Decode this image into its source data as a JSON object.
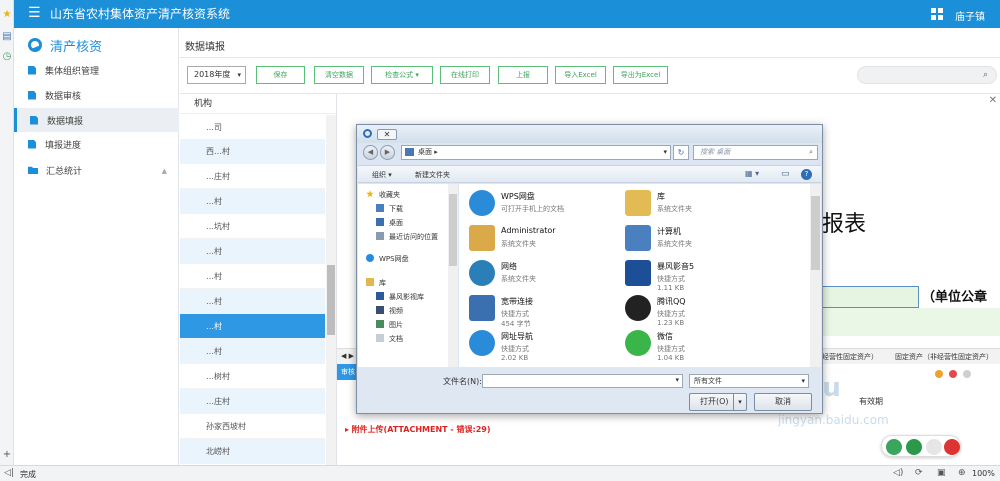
{
  "app": {
    "title": "山东省农村集体资产清产核资系统",
    "user": "庙子镇",
    "brand": "清产核资"
  },
  "sidebar": {
    "items": [
      {
        "label": "集体组织管理"
      },
      {
        "label": "数据审核"
      },
      {
        "label": "数据填报",
        "active": true
      },
      {
        "label": "填报进度"
      },
      {
        "label": "汇总统计"
      }
    ]
  },
  "breadcrumb": "数据填报",
  "toolbar": {
    "year": "2018年度",
    "buttons": [
      "保存",
      "清空数据",
      "检查公式",
      "在线打印",
      "上报",
      "导入Excel",
      "导出为Excel"
    ]
  },
  "org": {
    "header": "机构",
    "rows": [
      "…司",
      "西…村",
      "…庄村",
      "…村",
      "…坑村",
      "…村",
      "…村",
      "…村",
      "…村",
      "…村",
      "…树村",
      "…庄村",
      "孙家西坡村",
      "北崂村"
    ],
    "selected_index": 8
  },
  "content": {
    "title_fragment": "报表",
    "unit_fragment": "（单位公章",
    "tabs": [
      "经营性固定资产）",
      "固定资产（非经营性固定资产）"
    ],
    "sub_header": "审核",
    "attachment": "附件上传(ATTACHMENT - 错误:29)",
    "col_right": "有效期"
  },
  "dialog": {
    "title": "打开",
    "path": "桌面",
    "search_placeholder": "搜索 桌面",
    "organize": "组织 ▾",
    "new_folder": "新建文件夹",
    "nav": [
      "收藏夹",
      "下载",
      "桌面",
      "最近访问的位置",
      "WPS网盘",
      "库",
      "暴风影视库",
      "视频",
      "图片",
      "文档"
    ],
    "files": [
      {
        "name": "WPS网盘",
        "desc": "可打开手机上的文档",
        "icon": "cloud-icon"
      },
      {
        "name": "库",
        "desc": "系统文件夹",
        "icon": "library-folder-icon"
      },
      {
        "name": "Administrator",
        "desc": "系统文件夹",
        "icon": "user-folder-icon"
      },
      {
        "name": "计算机",
        "desc": "系统文件夹",
        "icon": "computer-icon"
      },
      {
        "name": "网络",
        "desc": "系统文件夹",
        "icon": "network-icon"
      },
      {
        "name": "暴风影音5",
        "desc": "快捷方式",
        "size": "1.11 KB",
        "icon": "media-player-icon"
      },
      {
        "name": "宽带连接",
        "desc": "快捷方式",
        "size": "454 字节",
        "icon": "broadband-icon"
      },
      {
        "name": "腾讯QQ",
        "desc": "快捷方式",
        "size": "1.23 KB",
        "icon": "qq-icon"
      },
      {
        "name": "网址导航",
        "desc": "快捷方式",
        "size": "2.02 KB",
        "icon": "browser-nav-icon"
      },
      {
        "name": "微信",
        "desc": "快捷方式",
        "size": "1.04 KB",
        "icon": "wechat-icon"
      }
    ],
    "filename_label": "文件名(N):",
    "filename_value": "",
    "filetype": "所有文件",
    "open_label": "打开(O)",
    "cancel_label": "取消"
  },
  "status": {
    "text": "完成",
    "zoom": "100%"
  },
  "colors": {
    "primary": "#1c8fd9",
    "green": "#3aa55c",
    "error": "#d22222"
  }
}
